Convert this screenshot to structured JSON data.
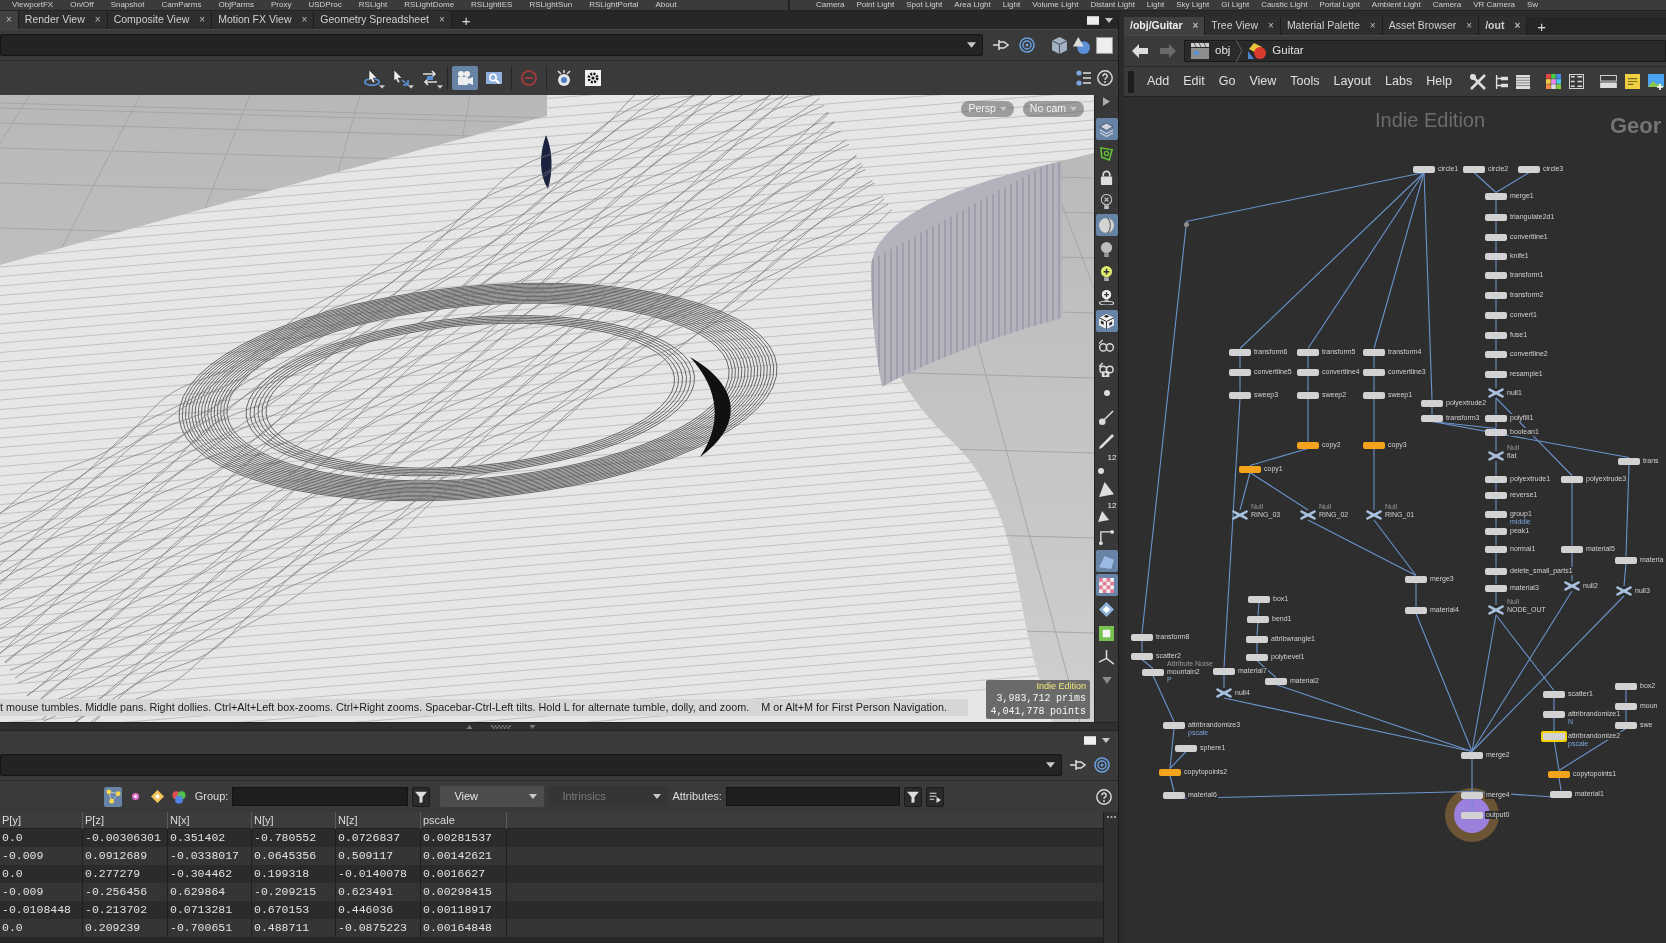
{
  "shelf": {
    "left_tools": [
      "ViewportFX",
      "On/Off",
      "Snapshot",
      "CamParms",
      "ObjParms",
      "Proxy",
      "USDProc",
      "RSLight",
      "RSLightDome",
      "RSLightIES",
      "RSLightSun",
      "RSLightPortal",
      "About"
    ],
    "right_tools": [
      "Camera",
      "Point Light",
      "Spot Light",
      "Area Light",
      "Light",
      "Volume Light",
      "Distant Light",
      "Light",
      "Sky Light",
      "GI Light",
      "Caustic Light",
      "Portal Light",
      "Ambient Light",
      "Camera",
      "VR Camera",
      "Sw"
    ]
  },
  "scene_pane": {
    "tabs": [
      {
        "close": "×",
        "selected": true
      },
      {
        "label": "Render View",
        "close": "×",
        "selected": false
      },
      {
        "label": "Composite View",
        "close": "×",
        "selected": false
      },
      {
        "label": "Motion FX View",
        "close": "×",
        "selected": false
      },
      {
        "label": "Geometry Spreadsheet",
        "close": "×",
        "selected": false
      }
    ],
    "add_tab": "+",
    "toolbar": [
      {
        "selected": false
      },
      {
        "selected": false
      },
      {
        "selected": false
      },
      {
        "selected": true
      },
      {
        "selected": false
      },
      {
        "selected": false
      },
      {
        "selected": false
      },
      {
        "selected": false
      }
    ],
    "viewport": {
      "view_menu": "Persp",
      "camera_menu": "No cam",
      "hints": [
        "t mouse tumbles. Middle pans. Right dollies. Ctrl+Alt+Left box-zooms. Ctrl+Right zooms. Spacebar-Ctrl-Left tilts. Hold L for alternate tumble, dolly, and zoom.",
        "M or Alt+M for First Person Navigation."
      ],
      "watermark": "Indie Edition",
      "stats": [
        {
          "value": "3,983,712",
          "unit": "prims"
        },
        {
          "value": "4,041,778",
          "unit": "points"
        }
      ],
      "side_tools": [
        {
          "selected": true
        },
        {
          "selected": false
        },
        {
          "selected": false
        },
        {
          "selected": false
        },
        {
          "selected": true
        },
        {
          "selected": false
        },
        {
          "selected": false
        },
        {
          "selected": false
        },
        {
          "selected": true
        },
        {
          "selected": false
        },
        {
          "selected": false
        },
        {
          "selected": false
        },
        {
          "selected": false
        },
        {
          "selected": false
        },
        {
          "selected": false,
          "badge": "12"
        },
        {
          "selected": false
        },
        {
          "selected": false,
          "badge": "12"
        },
        {
          "selected": false
        },
        {
          "selected": true
        },
        {
          "selected": true
        },
        {
          "selected": false
        },
        {
          "selected": false
        },
        {
          "selected": false
        }
      ]
    }
  },
  "spreadsheet_pane": {
    "element_types": [
      {
        "selected": true
      },
      {
        "selected": false
      },
      {
        "selected": false
      },
      {
        "selected": false
      }
    ],
    "group_label": "Group:",
    "view_menu": "View",
    "intrinsics_menu": {
      "label": "Intrinsics",
      "disabled": true
    },
    "attributes_label": "Attributes:",
    "columns": [
      "P[y]",
      "P[z]",
      "N[x]",
      "N[y]",
      "N[z]",
      "pscale"
    ],
    "rows": [
      [
        "0.0",
        "-0.00306301",
        "0.351402",
        "-0.780552",
        "0.0726837",
        "0.00281537"
      ],
      [
        "-0.009",
        "0.0912689",
        "-0.0338017",
        "0.0645356",
        "0.509117",
        "0.00142621"
      ],
      [
        "0.0",
        "0.277279",
        "-0.304462",
        "0.199318",
        "-0.0140078",
        "0.0016627"
      ],
      [
        "-0.009",
        "-0.256456",
        "0.629864",
        "-0.209215",
        "0.623491",
        "0.00298415"
      ],
      [
        "-0.0108448",
        "-0.213702",
        "0.0713281",
        "0.670153",
        "0.446036",
        "0.00118917"
      ],
      [
        "0.0",
        "0.209239",
        "-0.700651",
        "0.488711",
        "-0.0875223",
        "0.00164848"
      ]
    ]
  },
  "network_pane": {
    "tabs": [
      {
        "label": "/obj/Guitar",
        "kind": "network",
        "close": "×",
        "selected": true
      },
      {
        "label": "Tree View",
        "kind": "pane",
        "close": "×",
        "selected": false
      },
      {
        "label": "Material Palette",
        "kind": "pane",
        "close": "×",
        "selected": false
      },
      {
        "label": "Asset Browser",
        "kind": "pane",
        "close": "×",
        "selected": false
      },
      {
        "label": "/out",
        "kind": "network",
        "close": "×",
        "selected": false
      }
    ],
    "add_tab": "+",
    "back_button": {
      "disabled": false
    },
    "forward_button": {
      "disabled": true
    },
    "path": [
      "obj",
      "Guitar"
    ],
    "menu": [
      "Add",
      "Edit",
      "Go",
      "View",
      "Tools",
      "Layout",
      "Labs",
      "Help"
    ],
    "watermark": "Indie Edition",
    "context_label": "Geor",
    "nodes": [
      {
        "label": "circle1",
        "kind": "sop",
        "color": "#d2d2d2",
        "selected": false
      },
      {
        "label": "circle2",
        "kind": "sop",
        "color": "#d2d2d2",
        "selected": false
      },
      {
        "label": "circle3",
        "kind": "sop",
        "color": "#d2d2d2",
        "selected": false
      },
      {
        "label": "merge1",
        "kind": "sop",
        "color": "#d2d2d2",
        "selected": false
      },
      {
        "label": "triangulate2d1",
        "kind": "sop",
        "color": "#d2d2d2",
        "selected": false
      },
      {
        "kind": "dot",
        "color": "#8f8f8f",
        "selected": false
      },
      {
        "label": "convertline1",
        "kind": "sop",
        "color": "#d2d2d2",
        "selected": false
      },
      {
        "label": "knife1",
        "kind": "sop",
        "color": "#d2d2d2",
        "selected": false
      },
      {
        "label": "transform1",
        "kind": "sop",
        "color": "#d2d2d2",
        "selected": false
      },
      {
        "label": "transform2",
        "kind": "sop",
        "color": "#d2d2d2",
        "selected": false
      },
      {
        "label": "convert1",
        "kind": "sop",
        "color": "#d2d2d2",
        "selected": false
      },
      {
        "label": "fuse1",
        "kind": "sop",
        "color": "#d2d2d2",
        "selected": false
      },
      {
        "label": "transform6",
        "kind": "sop",
        "color": "#d2d2d2",
        "selected": false
      },
      {
        "label": "transform5",
        "kind": "sop",
        "color": "#d2d2d2",
        "selected": false
      },
      {
        "label": "transform4",
        "kind": "sop",
        "color": "#d2d2d2",
        "selected": false
      },
      {
        "label": "convertline2",
        "kind": "sop",
        "color": "#d2d2d2",
        "selected": false
      },
      {
        "label": "convertline5",
        "kind": "sop",
        "color": "#d2d2d2",
        "selected": false
      },
      {
        "label": "convertline4",
        "kind": "sop",
        "color": "#d2d2d2",
        "selected": false
      },
      {
        "label": "convertline3",
        "kind": "sop",
        "color": "#d2d2d2",
        "selected": false
      },
      {
        "label": "resample1",
        "kind": "sop",
        "color": "#d2d2d2",
        "selected": false
      },
      {
        "label": "sweep3",
        "kind": "sop",
        "color": "#d2d2d2",
        "selected": false
      },
      {
        "label": "sweep2",
        "kind": "sop",
        "color": "#d2d2d2",
        "selected": false
      },
      {
        "label": "sweep1",
        "kind": "sop",
        "color": "#d2d2d2",
        "selected": false
      },
      {
        "label": "null1",
        "kind": "null",
        "color": "#a9c2df",
        "selected": false
      },
      {
        "label": "polyextrude2",
        "kind": "sop",
        "color": "#d2d2d2",
        "selected": false
      },
      {
        "label": "transform3",
        "kind": "sop",
        "color": "#d2d2d2",
        "selected": false
      },
      {
        "label": "polyfill1",
        "kind": "sop",
        "color": "#d2d2d2",
        "selected": false
      },
      {
        "label": "boolean1",
        "kind": "sop",
        "color": "#d2d2d2",
        "selected": false
      },
      {
        "label": "copy2",
        "kind": "sop",
        "color": "#f3a41c",
        "selected": false
      },
      {
        "label": "copy3",
        "kind": "sop",
        "color": "#f3a41c",
        "selected": false
      },
      {
        "label": "flat",
        "kind": "null",
        "comment": "Null",
        "color": "#a9c2df",
        "selected": false
      },
      {
        "label": "trans",
        "kind": "sop",
        "color": "#d2d2d2",
        "selected": false
      },
      {
        "label": "copy1",
        "kind": "sop",
        "color": "#f3a41c",
        "selected": false
      },
      {
        "label": "polyextrude1",
        "kind": "sop",
        "color": "#d2d2d2",
        "selected": false
      },
      {
        "label": "polyextrude3",
        "kind": "sop",
        "color": "#d2d2d2",
        "selected": false
      },
      {
        "label": "reverse1",
        "kind": "sop",
        "color": "#d2d2d2",
        "selected": false
      },
      {
        "label": "RING_03",
        "kind": "null",
        "comment": "Null",
        "color": "#a9c2df",
        "selected": false
      },
      {
        "label": "RING_02",
        "kind": "null",
        "comment": "Null",
        "color": "#a9c2df",
        "selected": false
      },
      {
        "label": "RING_01",
        "kind": "null",
        "comment": "Null",
        "color": "#a9c2df",
        "selected": false
      },
      {
        "label": "group1",
        "kind": "sop",
        "note": "middle",
        "color": "#d2d2d2",
        "selected": false
      },
      {
        "label": "peak1",
        "kind": "sop",
        "color": "#d2d2d2",
        "selected": false
      },
      {
        "label": "normal1",
        "kind": "sop",
        "color": "#d2d2d2",
        "selected": false
      },
      {
        "label": "material5",
        "kind": "sop",
        "color": "#d2d2d2",
        "selected": false
      },
      {
        "label": "materia",
        "kind": "sop",
        "color": "#d2d2d2",
        "selected": false
      },
      {
        "label": "delete_small_parts1",
        "kind": "sop",
        "color": "#d2d2d2",
        "selected": false
      },
      {
        "label": "merge3",
        "kind": "sop",
        "color": "#d2d2d2",
        "selected": false
      },
      {
        "label": "material3",
        "kind": "sop",
        "color": "#d2d2d2",
        "selected": false
      },
      {
        "label": "null2",
        "kind": "null",
        "color": "#a9c2df",
        "selected": false
      },
      {
        "label": "null3",
        "kind": "null",
        "color": "#a9c2df",
        "selected": false
      },
      {
        "label": "box1",
        "kind": "sop",
        "color": "#d2d2d2",
        "selected": false
      },
      {
        "label": "material4",
        "kind": "sop",
        "color": "#d2d2d2",
        "selected": false
      },
      {
        "label": "NODE_OUT",
        "kind": "null",
        "comment": "Null",
        "color": "#a9c2df",
        "selected": false
      },
      {
        "label": "bend1",
        "kind": "sop",
        "color": "#d2d2d2",
        "selected": false
      },
      {
        "label": "transform8",
        "kind": "sop",
        "color": "#d2d2d2",
        "selected": false
      },
      {
        "label": "attribwrangle1",
        "kind": "sop",
        "color": "#d2d2d2",
        "selected": false
      },
      {
        "label": "scatter2",
        "kind": "sop",
        "color": "#d2d2d2",
        "selected": false
      },
      {
        "label": "polybevel1",
        "kind": "sop",
        "color": "#d2d2d2",
        "selected": false
      },
      {
        "label": "mountain2",
        "kind": "sop",
        "comment": "Attribute Noise",
        "note": "P",
        "color": "#d2d2d2",
        "selected": false
      },
      {
        "label": "material7",
        "kind": "sop",
        "color": "#d2d2d2",
        "selected": false
      },
      {
        "label": "material2",
        "kind": "sop",
        "color": "#d2d2d2",
        "selected": false
      },
      {
        "label": "box2",
        "kind": "sop",
        "color": "#d2d2d2",
        "selected": false
      },
      {
        "label": "null4",
        "kind": "null",
        "color": "#a9c2df",
        "selected": false
      },
      {
        "label": "scatter1",
        "kind": "sop",
        "color": "#d2d2d2",
        "selected": false
      },
      {
        "label": "moun",
        "kind": "sop",
        "color": "#d2d2d2",
        "selected": false
      },
      {
        "label": "attribrandomize1",
        "kind": "sop",
        "note": "N",
        "color": "#d2d2d2",
        "selected": false
      },
      {
        "label": "attribrandomize3",
        "kind": "sop",
        "note": "pscale",
        "color": "#d2d2d2",
        "selected": false
      },
      {
        "label": "swe",
        "kind": "sop",
        "color": "#d2d2d2",
        "selected": false
      },
      {
        "label": "attribrandomize2",
        "kind": "sop",
        "note": "pscale",
        "color": "#d2d2d2",
        "selected": true
      },
      {
        "label": "sphere1",
        "kind": "sop",
        "color": "#d2d2d2",
        "selected": false
      },
      {
        "label": "merge2",
        "kind": "sop",
        "color": "#d2d2d2",
        "selected": false
      },
      {
        "label": "copytopoints2",
        "kind": "sop",
        "color": "#f3a41c",
        "selected": false
      },
      {
        "label": "copytopoints1",
        "kind": "sop",
        "color": "#f3a41c",
        "selected": false
      },
      {
        "label": "material6",
        "kind": "sop",
        "color": "#d2d2d2",
        "selected": false
      },
      {
        "label": "merge4",
        "kind": "sop",
        "color": "#d2d2d2",
        "selected": false
      },
      {
        "label": "material1",
        "kind": "sop",
        "color": "#d2d2d2",
        "selected": false
      },
      {
        "label": "output0",
        "kind": "output",
        "color": "#9b80de",
        "selected": false
      }
    ]
  }
}
